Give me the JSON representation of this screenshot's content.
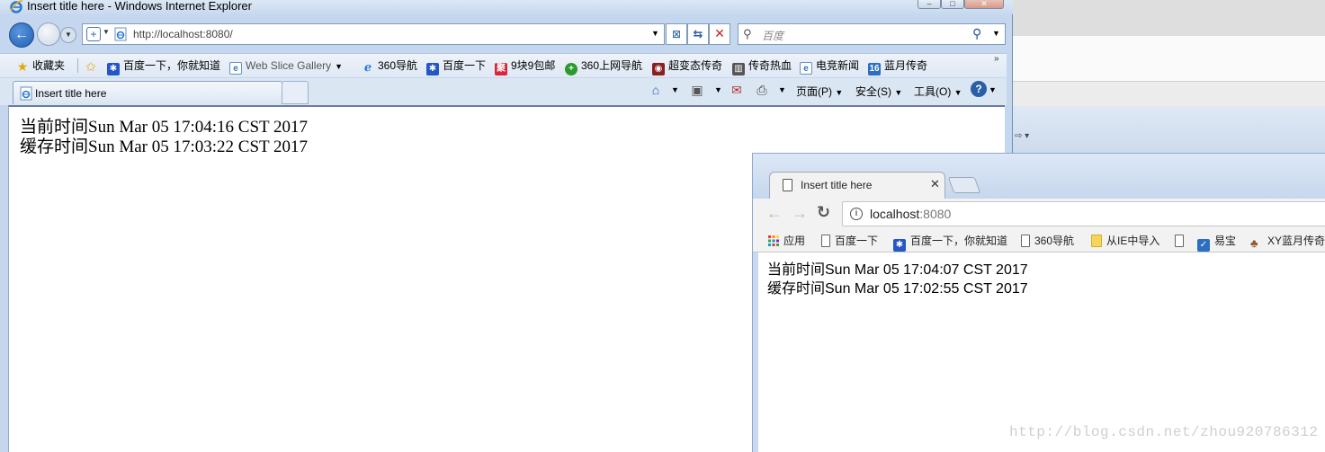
{
  "ie": {
    "title": "Insert title here - Windows Internet Explorer",
    "address_url": "http://localhost:8080/",
    "search_placeholder": "百度",
    "favorites_label": "收藏夹",
    "favorites": [
      {
        "label": "百度一下，你就知道",
        "icon": "baidu-paw-icon"
      },
      {
        "label": "Web Slice Gallery",
        "icon": "ie-page-icon"
      },
      {
        "label": "360导航",
        "icon": "ie-e-icon"
      },
      {
        "label": "百度一下",
        "icon": "baidu-paw-icon"
      },
      {
        "label": "9块9包邮",
        "icon": "red-square-icon"
      },
      {
        "label": "360上网导航",
        "icon": "green-plus-icon"
      },
      {
        "label": "超变态传奇",
        "icon": "game-icon"
      },
      {
        "label": "传奇热血",
        "icon": "game-icon"
      },
      {
        "label": "电竞新闻",
        "icon": "ie-page-icon"
      },
      {
        "label": "蓝月传奇",
        "icon": "game-icon"
      }
    ],
    "tab_title": "Insert title here",
    "commands": {
      "page": "页面(P)",
      "safety": "安全(S)",
      "tools": "工具(O)"
    },
    "content": {
      "line1": "当前时间Sun Mar 05 17:04:16 CST 2017",
      "line2": "缓存时间Sun Mar 05 17:03:22 CST 2017"
    }
  },
  "chrome": {
    "tab_title": "Insert title here",
    "url_host": "localhost",
    "url_port": ":8080",
    "bookmarks": [
      {
        "label": "应用",
        "icon": "apps-grid-icon"
      },
      {
        "label": "百度一下",
        "icon": "page-icon"
      },
      {
        "label": "百度一下，你就知道",
        "icon": "baidu-paw-icon"
      },
      {
        "label": "360导航",
        "icon": "page-icon"
      },
      {
        "label": "从IE中导入",
        "icon": "folder-icon"
      },
      {
        "label": "",
        "icon": "page-icon"
      },
      {
        "label": "易宝",
        "icon": "yibao-icon"
      },
      {
        "label": "XY蓝月传奇",
        "icon": "game-icon"
      }
    ],
    "content": {
      "line1": "当前时间Sun Mar 05 17:04:07 CST 2017",
      "line2": "缓存时间Sun Mar 05 17:02:55 CST 2017"
    }
  },
  "watermark": "http://blog.csdn.net/zhou920786312",
  "colors": {
    "ie_frame": "#c5d7ee",
    "chrome_frame": "#c9d9ee",
    "ie_back_button": "#1e5fb5"
  }
}
